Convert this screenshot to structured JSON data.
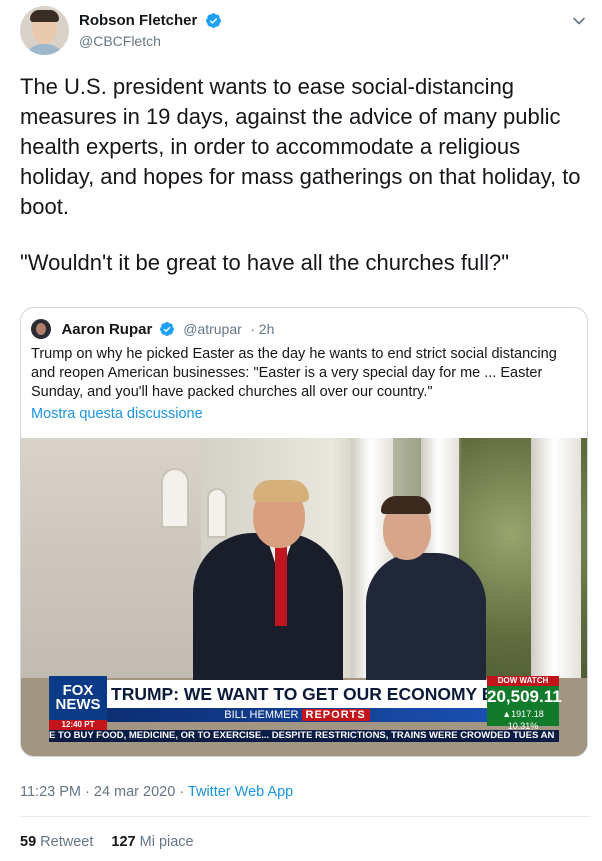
{
  "author": {
    "display_name": "Robson Fletcher",
    "handle": "@CBCFletch"
  },
  "tweet": {
    "paragraph1": "The U.S. president wants to ease social-distancing measures in 19 days, against the advice of many public health experts, in order to accommodate a religious holiday, and hopes for mass gatherings on that holiday, to boot.",
    "paragraph2": "\"Wouldn't it be great to have all the churches full?\""
  },
  "quoted_tweet": {
    "display_name": "Aaron Rupar",
    "handle": "@atrupar",
    "time": "· 2h",
    "text": "Trump on why he picked Easter as the day he wants to end strict social distancing and reopen American businesses: \"Easter is a very special day for me ... Easter Sunday, and you'll have packed churches all over our country.\"",
    "show_thread": "Mostra questa discussione",
    "video": {
      "logo_line1": "FOX",
      "logo_line2": "NEWS",
      "time": "12:40 PT",
      "headline": "TRUMP: WE WANT TO GET OUR ECONOMY BACK",
      "show_name": "BILL HEMMER",
      "show_suffix": "REPORTS",
      "dow_title": "DOW WATCH",
      "dow_value": "20,509.11",
      "dow_change": "▲1917.18 10.31%",
      "ticker": "E TO BUY FOOD, MEDICINE, OR TO EXERCISE...   DESPITE RESTRICTIONS, TRAINS WERE CROWDED TUES AN"
    }
  },
  "meta": {
    "timestamp": "11:23 PM · 24 mar 2020 · ",
    "app": "Twitter Web App"
  },
  "stats": {
    "retweets_count": "59",
    "retweets_label": "Retweet",
    "likes_count": "127",
    "likes_label": "Mi piace"
  },
  "colors": {
    "link": "#1b95e0",
    "verified": "#1da1f2",
    "secondary_text": "#657786"
  },
  "icons": [
    "verified-badge-icon",
    "chevron-down-icon"
  ]
}
